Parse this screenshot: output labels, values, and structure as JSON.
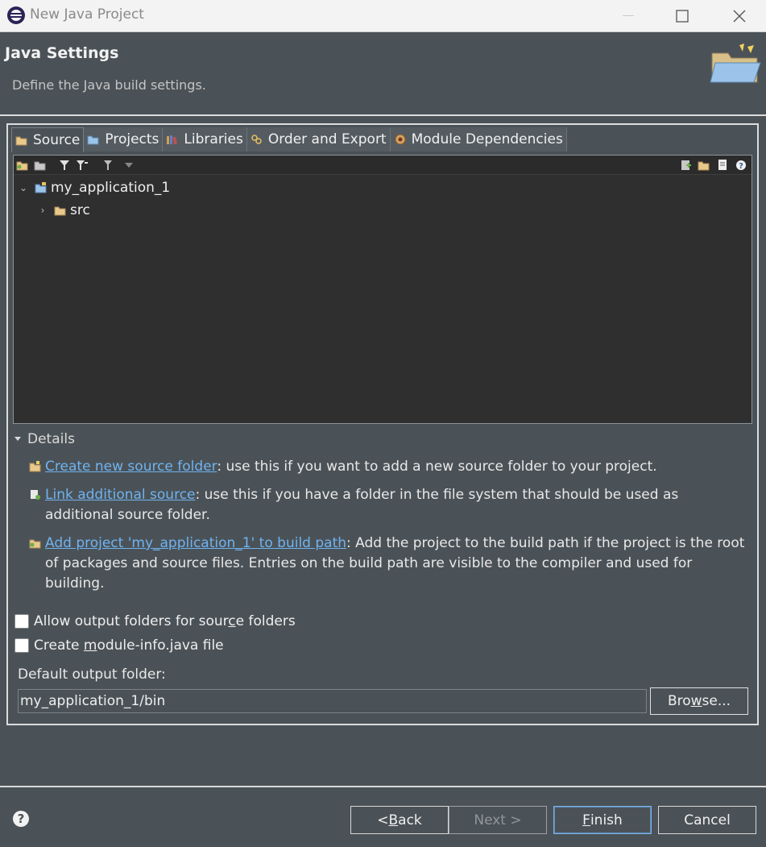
{
  "window": {
    "title": "New Java Project"
  },
  "banner": {
    "title": "Java Settings",
    "subtitle": "Define the Java build settings."
  },
  "tabs": [
    {
      "label": "Source"
    },
    {
      "label": "Projects"
    },
    {
      "label": "Libraries"
    },
    {
      "label": "Order and Export"
    },
    {
      "label": "Module Dependencies"
    }
  ],
  "tree": {
    "project": "my_application_1",
    "children": [
      {
        "label": "src"
      }
    ]
  },
  "details": {
    "header": "Details",
    "items": [
      {
        "link": "Create new source folder",
        "text": ": use this if you want to add a new source folder to your project."
      },
      {
        "link": "Link additional source",
        "text": ": use this if you have a folder in the file system that should be used as additional source folder."
      },
      {
        "link": "Add project 'my_application_1' to build path",
        "text": ": Add the project to the build path if the project is the root of packages and source files. Entries on the build path are visible to the compiler and used for building."
      }
    ]
  },
  "options": {
    "allow_output_pre": "Allow output folders for sour",
    "allow_output_mn": "c",
    "allow_output_post": "e folders",
    "module_info_pre": "Create ",
    "module_info_mn": "m",
    "module_info_post": "odule-info.java file"
  },
  "output": {
    "label": "Default output folder:",
    "value": "my_application_1/bin",
    "browse_pre": "Bro",
    "browse_mn": "w",
    "browse_post": "se..."
  },
  "footer": {
    "back_pre": "< ",
    "back_mn": "B",
    "back_post": "ack",
    "next": "Next >",
    "finish_mn": "F",
    "finish_post": "inish",
    "cancel": "Cancel"
  },
  "colors": {
    "link": "#6fb3f0",
    "background": "#4b5257",
    "tree_bg": "#2f2f2f"
  }
}
